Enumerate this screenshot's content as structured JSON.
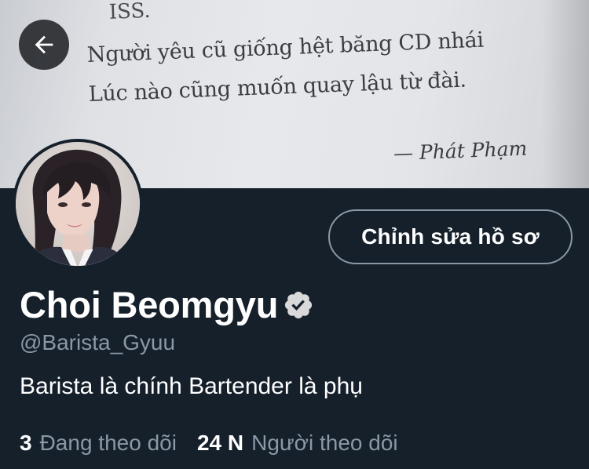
{
  "banner": {
    "top_fragment": "ISS.",
    "lines": [
      "Người yêu cũ giống hệt băng CD nhái",
      "Lúc nào cũng muốn quay lậu từ đài."
    ],
    "signature": "— Phát Phạm"
  },
  "nav": {
    "back_icon": "arrow-left-icon"
  },
  "profile": {
    "display_name": "Choi Beomgyu",
    "verified_icon": "verified-badge-icon",
    "handle": "@Barista_Gyuu",
    "bio": "Barista là chính Bartender là phụ",
    "edit_button_label": "Chỉnh sửa hồ sơ"
  },
  "stats": {
    "following_count": "3",
    "following_label": "Đang theo dõi",
    "followers_count": "24 N",
    "followers_label": "Người theo dõi"
  },
  "colors": {
    "background": "#15202b",
    "primary_text": "#ffffff",
    "secondary_text": "#8b98a5",
    "button_border": "#8b98a5"
  }
}
